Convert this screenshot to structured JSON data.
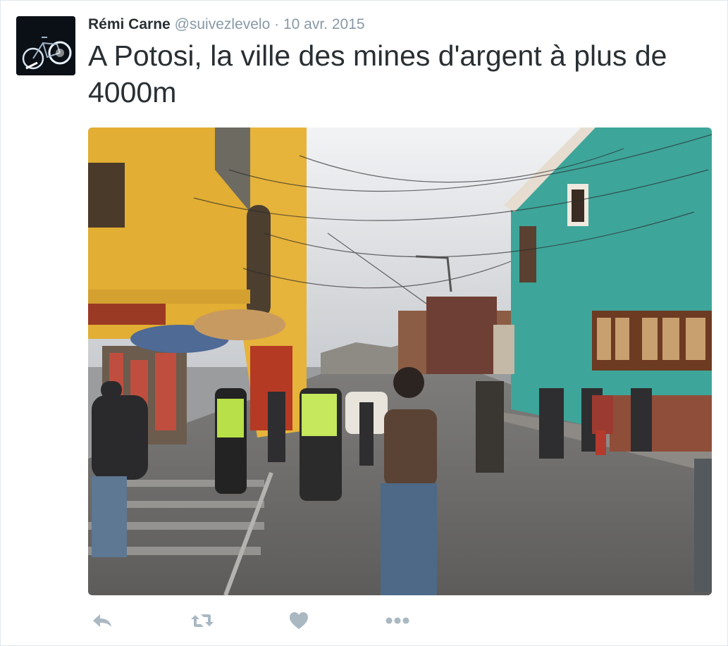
{
  "tweet": {
    "fullname": "Rémi Carne",
    "username": "@suivezlevelo",
    "separator": "·",
    "date": "10 avr. 2015",
    "text": "A Potosi, la ville des mines d'argent à plus de 4000m"
  },
  "media": {
    "type": "photo"
  },
  "actions": [
    {
      "name": "reply",
      "icon": "reply-icon"
    },
    {
      "name": "retweet",
      "icon": "retweet-icon"
    },
    {
      "name": "like",
      "icon": "heart-icon"
    },
    {
      "name": "more",
      "icon": "more-dots-icon"
    }
  ],
  "colors": {
    "text": "#292f33",
    "muted": "#8899a6",
    "action_icon": "#aab8c2",
    "border": "#e1e8ed"
  }
}
